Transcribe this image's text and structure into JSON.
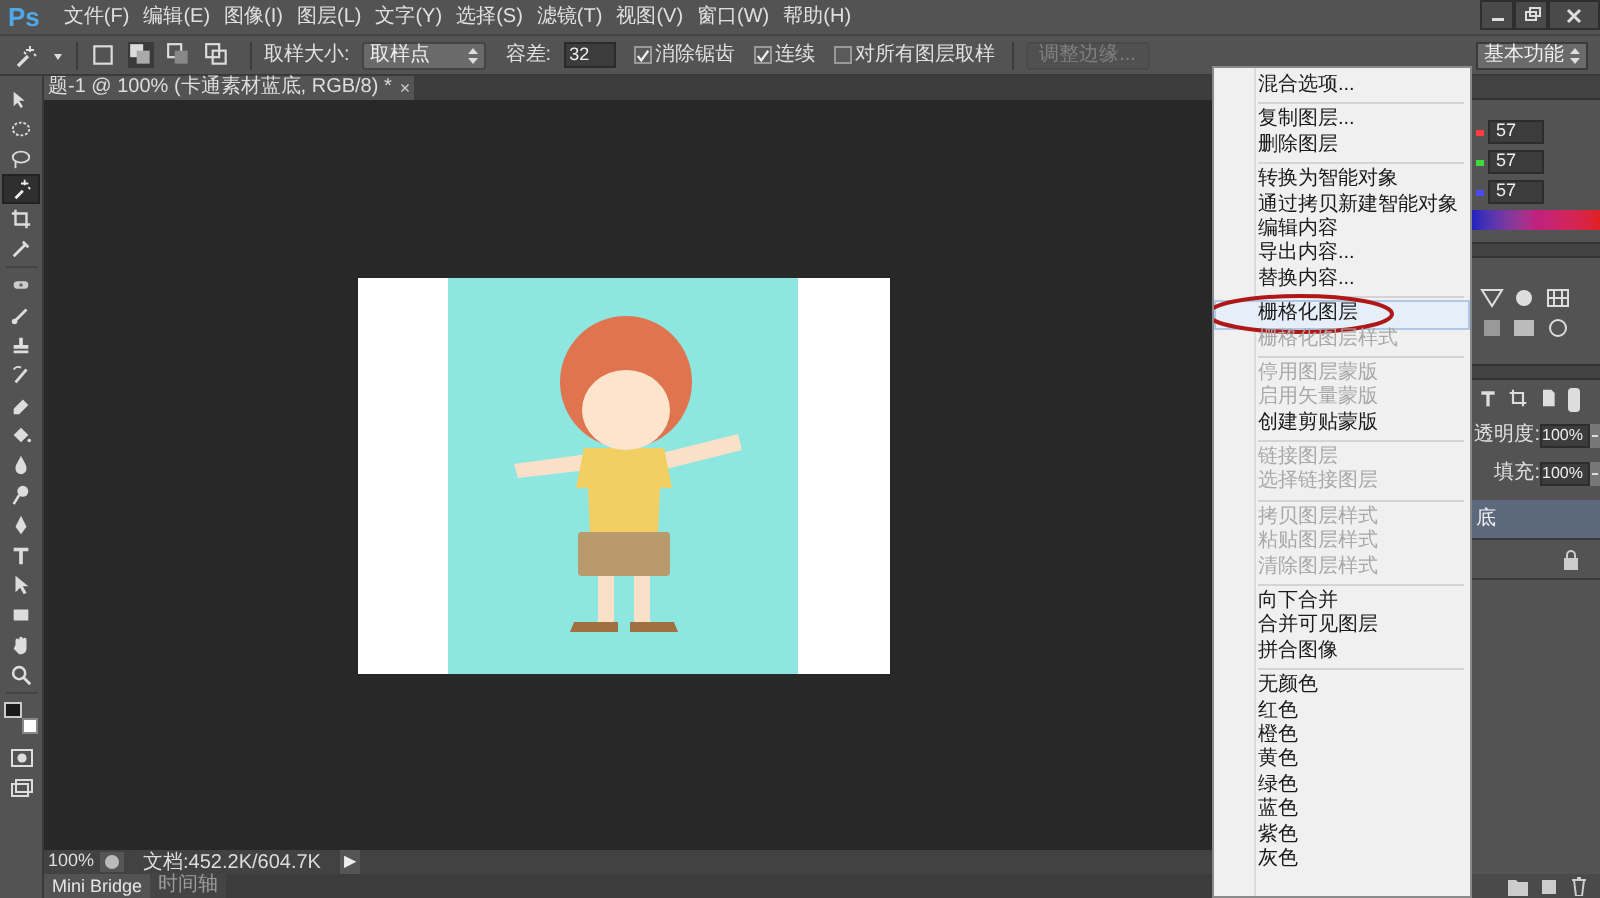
{
  "app": {
    "logo": "Ps",
    "menu": [
      "文件(F)",
      "编辑(E)",
      "图像(I)",
      "图层(L)",
      "文字(Y)",
      "选择(S)",
      "滤镜(T)",
      "视图(V)",
      "窗口(W)",
      "帮助(H)"
    ]
  },
  "options_bar": {
    "sample_size_label": "取样大小:",
    "sample_size": "取样点",
    "tolerance_label": "容差:",
    "tolerance": "32",
    "checkboxes": [
      {
        "label": "消除锯齿",
        "checked": true
      },
      {
        "label": "连续",
        "checked": true
      },
      {
        "label": "对所有图层取样",
        "checked": false
      }
    ],
    "refine_edge": {
      "label": "调整边缘...",
      "disabled": true
    },
    "workspace": "基本功能"
  },
  "document_tab": {
    "title": "题-1 @ 100% (卡通素材蓝底, RGB/8) *",
    "close": "×"
  },
  "tools": [
    {
      "selected": false
    },
    {
      "selected": false
    },
    {
      "selected": false
    },
    {
      "selected": true
    },
    {
      "selected": false
    },
    {
      "selected": false
    },
    {
      "selected": false
    },
    {
      "selected": false
    },
    {
      "selected": false
    },
    {
      "selected": false
    },
    {
      "selected": false
    },
    {
      "selected": false
    },
    {
      "selected": false
    },
    {
      "selected": false
    },
    {
      "selected": false
    },
    {
      "selected": false
    },
    {
      "selected": false
    },
    {
      "selected": false
    },
    {
      "selected": false
    },
    {
      "selected": false
    }
  ],
  "status_bar": {
    "zoom": "100%",
    "doc_size": "文档:452.2K/604.7K",
    "arrow": "▶"
  },
  "bottom_tabs": [
    {
      "label": "Mini Bridge",
      "selected": true
    },
    {
      "label": "时间轴",
      "selected": false
    }
  ],
  "color_panel": {
    "channels": [
      {
        "value": "57",
        "color": "#ff3b3b"
      },
      {
        "value": "57",
        "color": "#3bdc3b"
      },
      {
        "value": "57",
        "color": "#4a4aff"
      }
    ]
  },
  "layers_panel": {
    "opacity_label": "透明度:",
    "opacity": "100%",
    "fill_label": "填充:",
    "fill": "100%",
    "layers": [
      {
        "name": "底",
        "selected": true,
        "locked": false
      },
      {
        "selected": false,
        "locked": true
      }
    ]
  },
  "context_menu": {
    "groups": [
      [
        {
          "label": "混合选项...",
          "disabled": false,
          "selected": false,
          "circled": false
        }
      ],
      [
        {
          "label": "复制图层...",
          "disabled": false,
          "selected": false,
          "circled": false
        },
        {
          "label": "删除图层",
          "disabled": false,
          "selected": false,
          "circled": false
        }
      ],
      [
        {
          "label": "转换为智能对象",
          "disabled": false,
          "selected": false,
          "circled": false
        },
        {
          "label": "通过拷贝新建智能对象",
          "disabled": false,
          "selected": false,
          "circled": false
        },
        {
          "label": "编辑内容",
          "disabled": false,
          "selected": false,
          "circled": false
        },
        {
          "label": "导出内容...",
          "disabled": false,
          "selected": false,
          "circled": false
        },
        {
          "label": "替换内容...",
          "disabled": false,
          "selected": false,
          "circled": false
        }
      ],
      [
        {
          "label": "栅格化图层",
          "disabled": false,
          "selected": true,
          "circled": true
        },
        {
          "label": "栅格化图层样式",
          "disabled": true,
          "selected": false,
          "circled": false
        }
      ],
      [
        {
          "label": "停用图层蒙版",
          "disabled": true,
          "selected": false,
          "circled": false
        },
        {
          "label": "启用矢量蒙版",
          "disabled": true,
          "selected": false,
          "circled": false
        },
        {
          "label": "创建剪贴蒙版",
          "disabled": false,
          "selected": false,
          "circled": false
        }
      ],
      [
        {
          "label": "链接图层",
          "disabled": true,
          "selected": false,
          "circled": false
        },
        {
          "label": "选择链接图层",
          "disabled": true,
          "selected": false,
          "circled": false
        }
      ],
      [
        {
          "label": "拷贝图层样式",
          "disabled": true,
          "selected": false,
          "circled": false
        },
        {
          "label": "粘贴图层样式",
          "disabled": true,
          "selected": false,
          "circled": false
        },
        {
          "label": "清除图层样式",
          "disabled": true,
          "selected": false,
          "circled": false
        }
      ],
      [
        {
          "label": "向下合并",
          "disabled": false,
          "selected": false,
          "circled": false
        },
        {
          "label": "合并可见图层",
          "disabled": false,
          "selected": false,
          "circled": false
        },
        {
          "label": "拼合图像",
          "disabled": false,
          "selected": false,
          "circled": false
        }
      ],
      [
        {
          "label": "无颜色",
          "disabled": false,
          "selected": false,
          "circled": false
        },
        {
          "label": "红色",
          "disabled": false,
          "selected": false,
          "circled": false
        },
        {
          "label": "橙色",
          "disabled": false,
          "selected": false,
          "circled": false
        },
        {
          "label": "黄色",
          "disabled": false,
          "selected": false,
          "circled": false
        },
        {
          "label": "绿色",
          "disabled": false,
          "selected": false,
          "circled": false
        },
        {
          "label": "蓝色",
          "disabled": false,
          "selected": false,
          "circled": false
        },
        {
          "label": "紫色",
          "disabled": false,
          "selected": false,
          "circled": false
        },
        {
          "label": "灰色",
          "disabled": false,
          "selected": false,
          "circled": false
        }
      ]
    ]
  }
}
